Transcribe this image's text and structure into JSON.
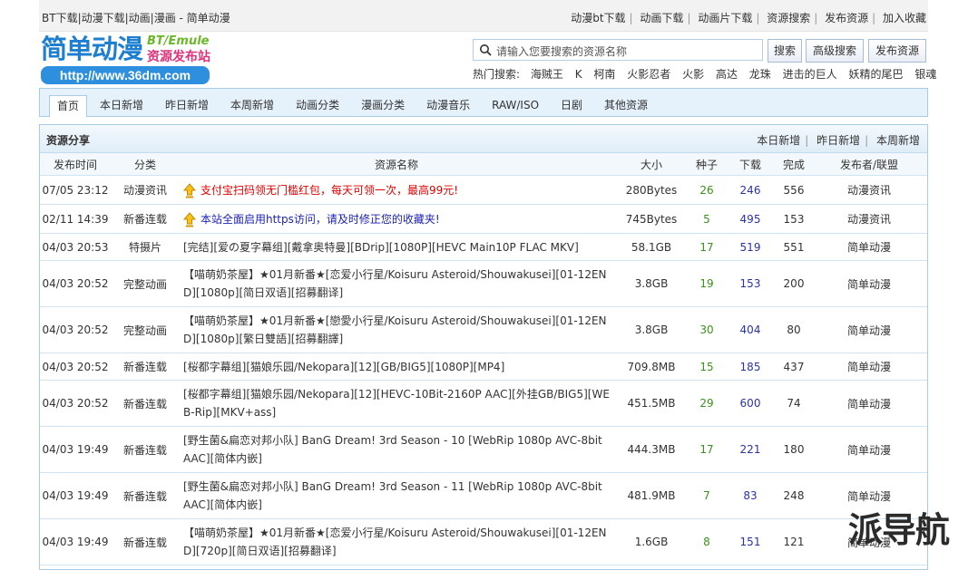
{
  "topbar": {
    "left": "BT下载|动漫下载|动画|漫画 - 简单动漫",
    "links": [
      "动漫bt下载",
      "动画下载",
      "动画片下载",
      "资源搜索",
      "发布资源",
      "加入收藏"
    ]
  },
  "logo": {
    "name": "简单动漫",
    "en": "BT/Emule",
    "sub": "资源发布站",
    "url": "http://www.36dm.com"
  },
  "search": {
    "placeholder": "请输入您要搜索的资源名称",
    "search_btn": "搜索",
    "advanced_btn": "高级搜索",
    "publish_btn": "发布资源"
  },
  "hot": {
    "label": "热门搜索:",
    "items": [
      "海贼王",
      "K",
      "柯南",
      "火影忍者",
      "火影",
      "高达",
      "龙珠",
      "进击的巨人",
      "妖精的尾巴",
      "银魂"
    ]
  },
  "nav": [
    "首页",
    "本日新增",
    "昨日新增",
    "本周新增",
    "动画分类",
    "漫画分类",
    "动漫音乐",
    "RAW/ISO",
    "日剧",
    "其他资源"
  ],
  "panel": {
    "title": "资源分享",
    "links": [
      "本日新增",
      "昨日新增",
      "本周新增"
    ]
  },
  "columns": [
    "发布时间",
    "分类",
    "资源名称",
    "大小",
    "种子",
    "下载",
    "完成",
    "发布者/联盟"
  ],
  "rows": [
    {
      "time": "07/05 23:12",
      "cat": "动漫资讯",
      "name": "支付宝扫码领无门槛红包，每天可领一次，最高99元!",
      "size": "280Bytes",
      "seed": "26",
      "dl": "246",
      "done": "556",
      "pub": "动漫资讯"
    },
    {
      "time": "02/11 14:39",
      "cat": "新番连载",
      "name": "本站全面启用https访问，请及时修正您的收藏夹!",
      "size": "745Bytes",
      "seed": "5",
      "dl": "495",
      "done": "153",
      "pub": "动漫资讯"
    },
    {
      "time": "04/03 20:53",
      "cat": "特摄片",
      "name": "[完结][爱の夏字幕组][戴拿奥特曼][BDrip][1080P][HEVC Main10P FLAC MKV]",
      "size": "58.1GB",
      "seed": "17",
      "dl": "519",
      "done": "551",
      "pub": "简单动漫"
    },
    {
      "time": "04/03 20:52",
      "cat": "完整动画",
      "name": "【喵萌奶茶屋】★01月新番★[恋爱小行星/Koisuru Asteroid/Shouwakusei][01-12END][1080p][简日双语][招募翻译]",
      "size": "3.8GB",
      "seed": "19",
      "dl": "153",
      "done": "200",
      "pub": "简单动漫"
    },
    {
      "time": "04/03 20:52",
      "cat": "完整动画",
      "name": "【喵萌奶茶屋】★01月新番★[戀愛小行星/Koisuru Asteroid/Shouwakusei][01-12END][1080p][繁日雙語][招募翻譯]",
      "size": "3.8GB",
      "seed": "30",
      "dl": "404",
      "done": "80",
      "pub": "简单动漫"
    },
    {
      "time": "04/03 20:52",
      "cat": "新番连载",
      "name": "[桜都字幕组][猫娘乐园/Nekopara][12][GB/BIG5][1080P][MP4]",
      "size": "709.8MB",
      "seed": "15",
      "dl": "185",
      "done": "437",
      "pub": "简单动漫"
    },
    {
      "time": "04/03 20:52",
      "cat": "新番连载",
      "name": "[桜都字幕组][猫娘乐园/Nekopara][12][HEVC-10Bit-2160P AAC][外挂GB/BIG5][WEB-Rip][MKV+ass]",
      "size": "451.5MB",
      "seed": "29",
      "dl": "600",
      "done": "74",
      "pub": "简单动漫"
    },
    {
      "time": "04/03 19:49",
      "cat": "新番连载",
      "name": "[野生菌&扁恋对邦小队] BanG Dream! 3rd Season - 10 [WebRip 1080p AVC-8bit AAC][简体内嵌]",
      "size": "444.3MB",
      "seed": "17",
      "dl": "221",
      "done": "180",
      "pub": "简单动漫"
    },
    {
      "time": "04/03 19:49",
      "cat": "新番连载",
      "name": "[野生菌&扁恋对邦小队] BanG Dream! 3rd Season - 11 [WebRip 1080p AVC-8bit AAC][简体内嵌]",
      "size": "481.9MB",
      "seed": "7",
      "dl": "83",
      "done": "248",
      "pub": "简单动漫"
    },
    {
      "time": "04/03 19:49",
      "cat": "新番连载",
      "name": "【喵萌奶茶屋】★01月新番★[恋爱小行星/Koisuru Asteroid/Shouwakusei][01-12END][720p][简日双语][招募翻译]",
      "size": "1.6GB",
      "seed": "8",
      "dl": "151",
      "done": "121",
      "pub": "简单动漫"
    }
  ],
  "watermark": "派导航"
}
